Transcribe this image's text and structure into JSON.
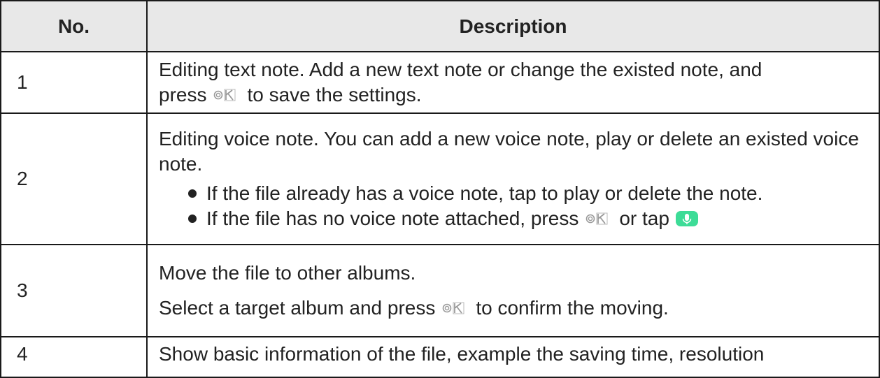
{
  "headers": {
    "no": "No.",
    "description": "Description"
  },
  "rows": [
    {
      "no": "1",
      "text_a": "Editing text note. Add a new text note or change the existed note, and",
      "text_b": "press",
      "text_c": "to save the settings."
    },
    {
      "no": "2",
      "text_a": "Editing voice note. You can add a new voice note, play or delete an existed voice note.",
      "bullet_1": "If the file already has a voice note, tap to play or delete the note.",
      "bullet_2_a": "If the file has no voice note attached, press",
      "bullet_2_b": "or tap"
    },
    {
      "no": "3",
      "text_a": "Move the file to other albums.",
      "text_b": "Select a target album and press",
      "text_c": "to confirm the moving."
    },
    {
      "no": "4",
      "text_a": "Show basic information of the file, example the saving time, resolution"
    }
  ],
  "icons": {
    "ok": "ok-button-icon",
    "mic": "microphone-icon",
    "mic_color": "#3ddc97"
  }
}
